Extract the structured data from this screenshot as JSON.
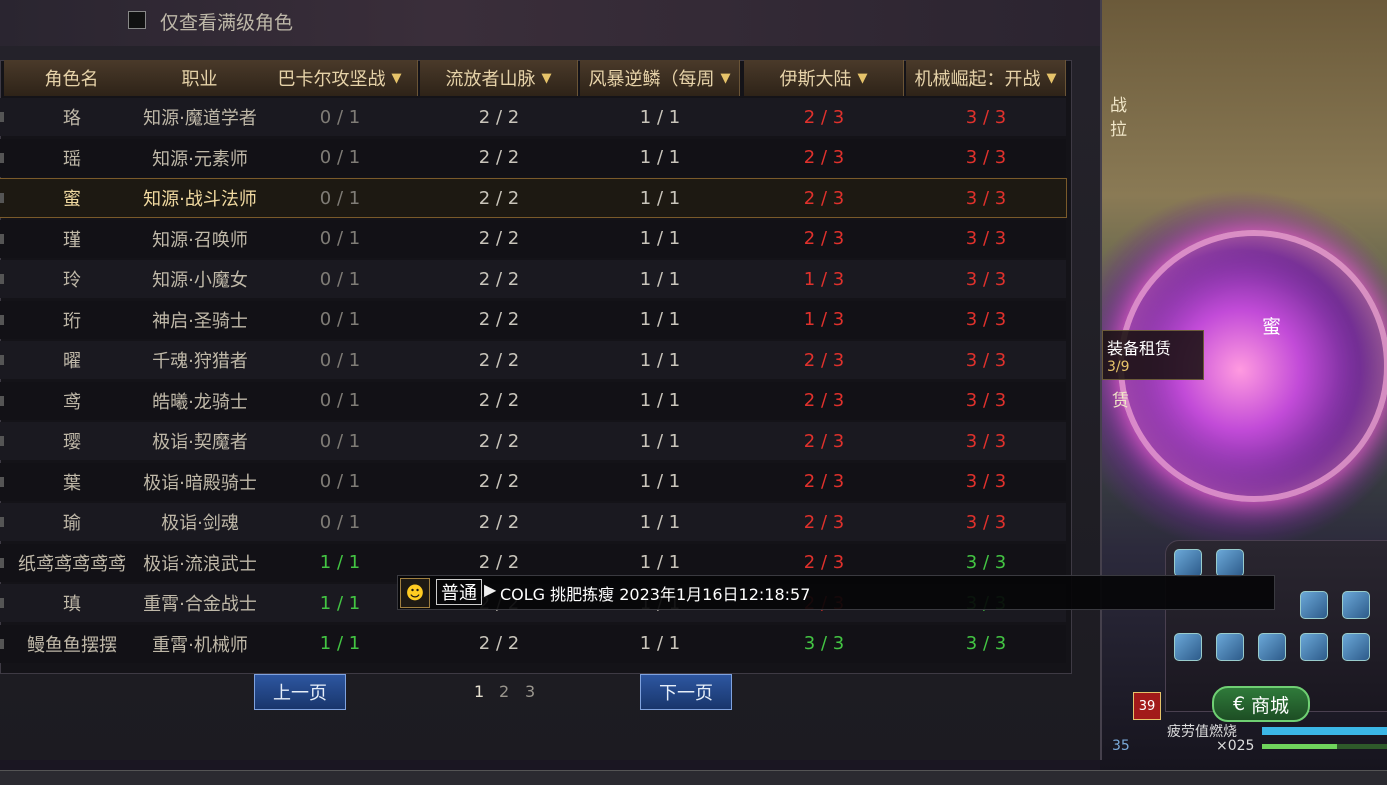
{
  "filter": {
    "label": "仅查看满级角色"
  },
  "columns": [
    "角色名",
    "职业",
    "巴卡尔攻坚战",
    "流放者山脉",
    "风暴逆鳞（每周",
    "伊斯大陆",
    "机械崛起：开战"
  ],
  "rows": [
    {
      "name": "珞",
      "job": "知源·魔道学者",
      "d": [
        "0 / 1",
        "2 / 2",
        "1 / 1",
        "2 / 3",
        "3 / 3"
      ],
      "c": [
        "gray",
        "white",
        "white",
        "red",
        "red"
      ]
    },
    {
      "name": "瑶",
      "job": "知源·元素师",
      "d": [
        "0 / 1",
        "2 / 2",
        "1 / 1",
        "2 / 3",
        "3 / 3"
      ],
      "c": [
        "gray",
        "white",
        "white",
        "red",
        "red"
      ]
    },
    {
      "name": "蜜",
      "job": "知源·战斗法师",
      "d": [
        "0 / 1",
        "2 / 2",
        "1 / 1",
        "2 / 3",
        "3 / 3"
      ],
      "c": [
        "gray",
        "white",
        "white",
        "red",
        "red"
      ],
      "selected": true
    },
    {
      "name": "瑾",
      "job": "知源·召唤师",
      "d": [
        "0 / 1",
        "2 / 2",
        "1 / 1",
        "2 / 3",
        "3 / 3"
      ],
      "c": [
        "gray",
        "white",
        "white",
        "red",
        "red"
      ]
    },
    {
      "name": "玲",
      "job": "知源·小魔女",
      "d": [
        "0 / 1",
        "2 / 2",
        "1 / 1",
        "1 / 3",
        "3 / 3"
      ],
      "c": [
        "gray",
        "white",
        "white",
        "red",
        "red"
      ]
    },
    {
      "name": "珩",
      "job": "神启·圣骑士",
      "d": [
        "0 / 1",
        "2 / 2",
        "1 / 1",
        "1 / 3",
        "3 / 3"
      ],
      "c": [
        "gray",
        "white",
        "white",
        "red",
        "red"
      ]
    },
    {
      "name": "曜",
      "job": "千魂·狩猎者",
      "d": [
        "0 / 1",
        "2 / 2",
        "1 / 1",
        "2 / 3",
        "3 / 3"
      ],
      "c": [
        "gray",
        "white",
        "white",
        "red",
        "red"
      ]
    },
    {
      "name": "鸢",
      "job": "皓曦·龙骑士",
      "d": [
        "0 / 1",
        "2 / 2",
        "1 / 1",
        "2 / 3",
        "3 / 3"
      ],
      "c": [
        "gray",
        "white",
        "white",
        "red",
        "red"
      ]
    },
    {
      "name": "璎",
      "job": "极诣·契魔者",
      "d": [
        "0 / 1",
        "2 / 2",
        "1 / 1",
        "2 / 3",
        "3 / 3"
      ],
      "c": [
        "gray",
        "white",
        "white",
        "red",
        "red"
      ]
    },
    {
      "name": "葉",
      "job": "极诣·暗殿骑士",
      "d": [
        "0 / 1",
        "2 / 2",
        "1 / 1",
        "2 / 3",
        "3 / 3"
      ],
      "c": [
        "gray",
        "white",
        "white",
        "red",
        "red"
      ]
    },
    {
      "name": "瑜",
      "job": "极诣·剑魂",
      "d": [
        "0 / 1",
        "2 / 2",
        "1 / 1",
        "2 / 3",
        "3 / 3"
      ],
      "c": [
        "gray",
        "white",
        "white",
        "red",
        "red"
      ]
    },
    {
      "name": "纸鸢鸢鸢鸢鸢",
      "job": "极诣·流浪武士",
      "d": [
        "1 / 1",
        "2 / 2",
        "1 / 1",
        "2 / 3",
        "3 / 3"
      ],
      "c": [
        "green",
        "white",
        "white",
        "red",
        "green"
      ]
    },
    {
      "name": "瑱",
      "job": "重霄·合金战士",
      "d": [
        "1 / 1",
        "2 / 2",
        "1 / 1",
        "2 / 3",
        "3 / 3"
      ],
      "c": [
        "green",
        "white",
        "white",
        "red",
        "green"
      ]
    },
    {
      "name": "鳗鱼鱼摆摆",
      "job": "重霄·机械师",
      "d": [
        "1 / 1",
        "2 / 2",
        "1 / 1",
        "3 / 3",
        "3 / 3"
      ],
      "c": [
        "green",
        "white",
        "white",
        "green",
        "green"
      ]
    }
  ],
  "pager": {
    "prev": "上一页",
    "next": "下一页",
    "pages": [
      "1",
      "2",
      "3"
    ],
    "current": "1"
  },
  "chat": {
    "icon": "smiley-icon",
    "channel": "普通",
    "message": "COLG 挑肥拣瘦 2023年1月16日12:18:57"
  },
  "scene": {
    "character_name": "蜜",
    "rent_label": "装备租赁",
    "rent_count": "3/9",
    "side_text": [
      "战",
      "拉"
    ],
    "lease_text": "赁"
  },
  "hud": {
    "shop_label": "商城",
    "level": "39",
    "fatigue_label": "疲劳值燃烧",
    "item_count": "×025",
    "coord": "35",
    "exp_fill": 0.6
  },
  "colors": {
    "red": "#e0312c",
    "green": "#43c543",
    "header_text": "#e6d2a8",
    "button_blue": "#2d56a0"
  }
}
